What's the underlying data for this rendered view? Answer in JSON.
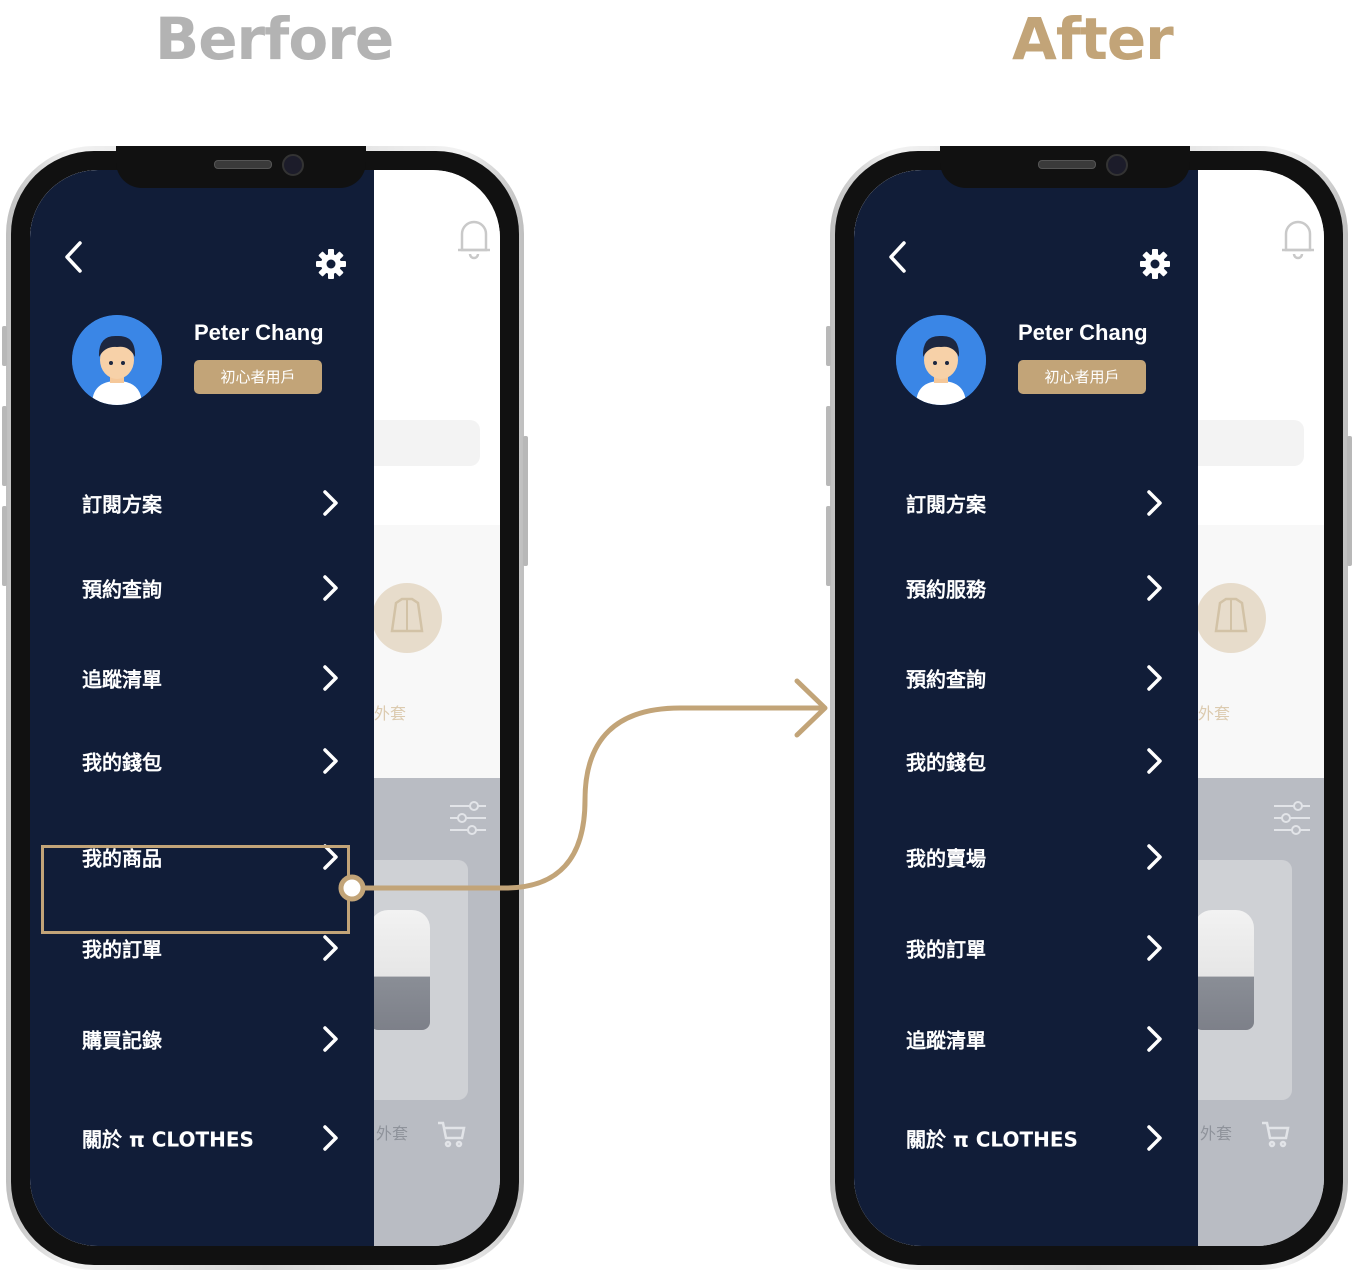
{
  "headings": {
    "before": "Berfore",
    "after": "After"
  },
  "user": {
    "name": "Peter Chang",
    "badge": "初心者用戶"
  },
  "background": {
    "category_label": "外套",
    "item_label": "外套"
  },
  "before_menu": [
    "訂閱方案",
    "預約查詢",
    "追蹤清單",
    "我的錢包",
    "我的商品",
    "我的訂單",
    "購買記錄",
    "關於 π CLOTHES"
  ],
  "after_menu": [
    "訂閱方案",
    "預約服務",
    "預約查詢",
    "我的錢包",
    "我的賣場",
    "我的訂單",
    "追蹤清單",
    "關於 π CLOTHES"
  ],
  "highlighted_item": "我的商品",
  "colors": {
    "drawer": "#111d38",
    "accent": "#c2a478",
    "before_heading": "#b3b3b3"
  },
  "icons": [
    "back-arrow-icon",
    "gear-icon",
    "bell-icon",
    "chevron-right-icon",
    "filter-icon",
    "cart-icon",
    "jacket-icon"
  ]
}
